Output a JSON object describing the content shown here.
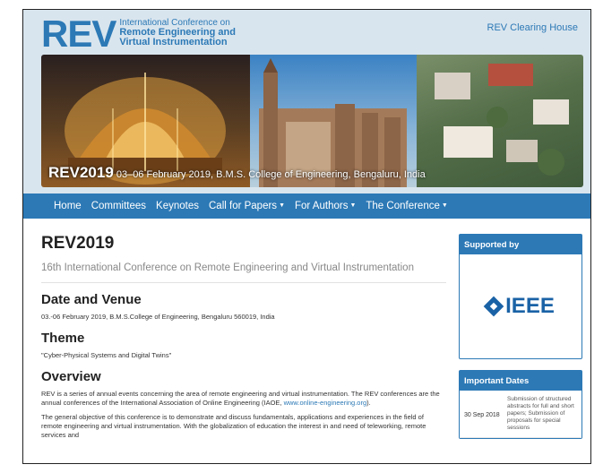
{
  "header": {
    "logo": "REV",
    "logo_line1": "International Conference on",
    "logo_line2": "Remote Engineering and",
    "logo_line3": "Virtual Instrumentation",
    "clearing_house": "REV Clearing House"
  },
  "banner": {
    "big": "REV2019",
    "small": " 03–06 February 2019, B.M.S. College of Engineering, Bengaluru, India"
  },
  "nav": {
    "items": [
      "Home",
      "Committees",
      "Keynotes",
      "Call for Papers",
      "For Authors",
      "The Conference"
    ]
  },
  "main": {
    "title": "REV2019",
    "subtitle": "16th International Conference on Remote Engineering and Virtual Instrumentation",
    "date_venue_heading": "Date and Venue",
    "date_venue_text": "03.-06 February 2019, B.M.S.College of Engineering, Bengaluru 560019, India",
    "theme_heading": "Theme",
    "theme_text": "\"Cyber-Physical Systems and Digital Twins\"",
    "overview_heading": "Overview",
    "overview_text1": "REV is a series of annual events concerning the area of remote engineering and virtual instrumentation. The REV conferences are the annual conferences of the International Association of Online Engineering (IAOE, ",
    "overview_link": "www.online-engineering.org",
    "overview_text1_end": ").",
    "overview_text2": "The general objective of this conference is to demonstrate and discuss fundamentals, applications and experiences in the field of remote engineering and virtual instrumentation. With the globalization of education the interest in and need of teleworking, remote services and"
  },
  "sidebar": {
    "supported_heading": "Supported by",
    "ieee": "IEEE",
    "important_heading": "Important Dates",
    "dates": [
      {
        "date": "30 Sep 2018",
        "desc": "Submission of structured abstracts for full and short papers; Submission of proposals for special sessions"
      }
    ]
  }
}
